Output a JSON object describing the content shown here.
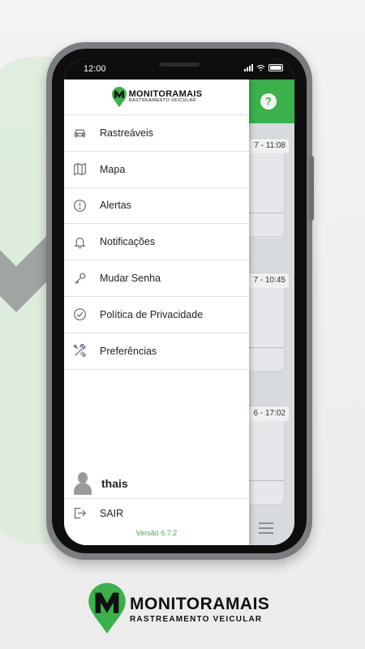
{
  "status_bar": {
    "time": "12:00"
  },
  "brand": {
    "name": "MONITORAMAIS",
    "tagline": "RASTREAMENTO VEICULAR",
    "primary_color": "#3ab14a"
  },
  "background_app": {
    "help_label": "?",
    "events": [
      {
        "time": "7 - 11:08"
      },
      {
        "time": "7 - 10:45"
      },
      {
        "time": "6 - 17:02"
      }
    ]
  },
  "drawer": {
    "menu": [
      {
        "label": "Rastreáveis",
        "icon": "car-icon"
      },
      {
        "label": "Mapa",
        "icon": "map-icon"
      },
      {
        "label": "Alertas",
        "icon": "alert-circle-icon"
      },
      {
        "label": "Notificações",
        "icon": "bell-icon"
      },
      {
        "label": "Mudar Senha",
        "icon": "key-icon"
      },
      {
        "label": "Política de Privacidade",
        "icon": "check-circle-icon"
      },
      {
        "label": "Preferências",
        "icon": "tools-icon"
      }
    ],
    "user": {
      "name": "thais"
    },
    "logout_label": "SAIR",
    "version": "Versão 6.7.2"
  }
}
